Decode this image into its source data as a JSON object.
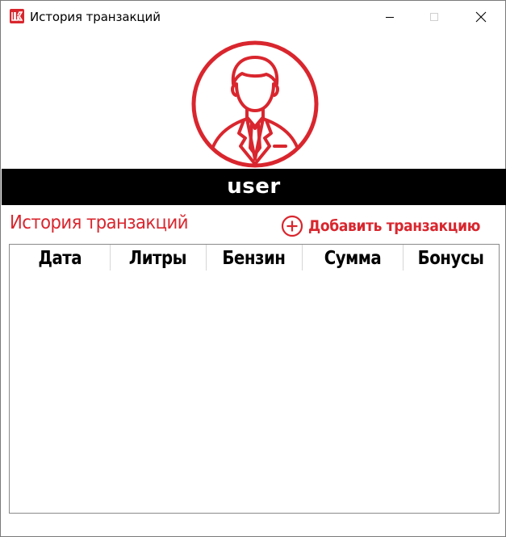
{
  "window": {
    "title": "История транзакций",
    "icon": "lukoil-logo-icon",
    "controls": [
      "minimize-icon",
      "maximize-icon",
      "close-icon"
    ]
  },
  "profile": {
    "avatar_icon": "user-avatar-icon",
    "username": "user"
  },
  "history": {
    "title": "История транзакций",
    "add_button_label": "Добавить транзакцию",
    "add_button_icon": "plus-circle-icon"
  },
  "table": {
    "columns": [
      "Дата",
      "Литры",
      "Бензин",
      "Сумма",
      "Бонусы"
    ],
    "rows": []
  },
  "colors": {
    "accent": "#d9262e",
    "header_bar": "#000000"
  }
}
